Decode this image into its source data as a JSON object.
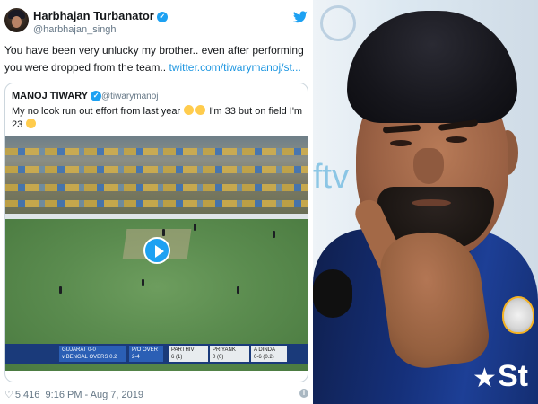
{
  "tweet": {
    "author_name": "Harbhajan Turbanator",
    "author_handle": "@harbhajan_singh",
    "text_main": "You have been very unlucky my brother.. even after performing you were dropped from the team.. ",
    "link_text": "twitter.com/tiwarymanoj/st...",
    "likes": "5,416",
    "timestamp": "9:16 PM - Aug 7, 2019",
    "quoted": {
      "author_name": "MANOJ TIWARY",
      "author_handle": "@tiwarymanoj",
      "text_part1": "My no look run out effort from last year ",
      "text_part2": " I'm 33 but on field I'm 23 "
    },
    "video": {
      "scorebar": {
        "team": "GUJARAT",
        "team_score": "0-0",
        "team_sub": "v BENGAL OVERS 0.2",
        "overs_label": "P/O OVER",
        "overs_value": "2-4",
        "batter1_name": "PARTHIV",
        "batter1_score": "6 (1)",
        "batter2_name": "PRIYANK",
        "batter2_score": "0 (0)",
        "bowler_name": "A DINDA",
        "bowler_figures": "0-6 (0.2)"
      }
    }
  },
  "photo": {
    "jersey_text": "St",
    "backdrop_text": "ftv"
  },
  "colors": {
    "twitter_blue": "#1da1f2",
    "link_blue": "#1b95e0",
    "muted_gray": "#657786",
    "jersey_navy": "#15307a"
  }
}
